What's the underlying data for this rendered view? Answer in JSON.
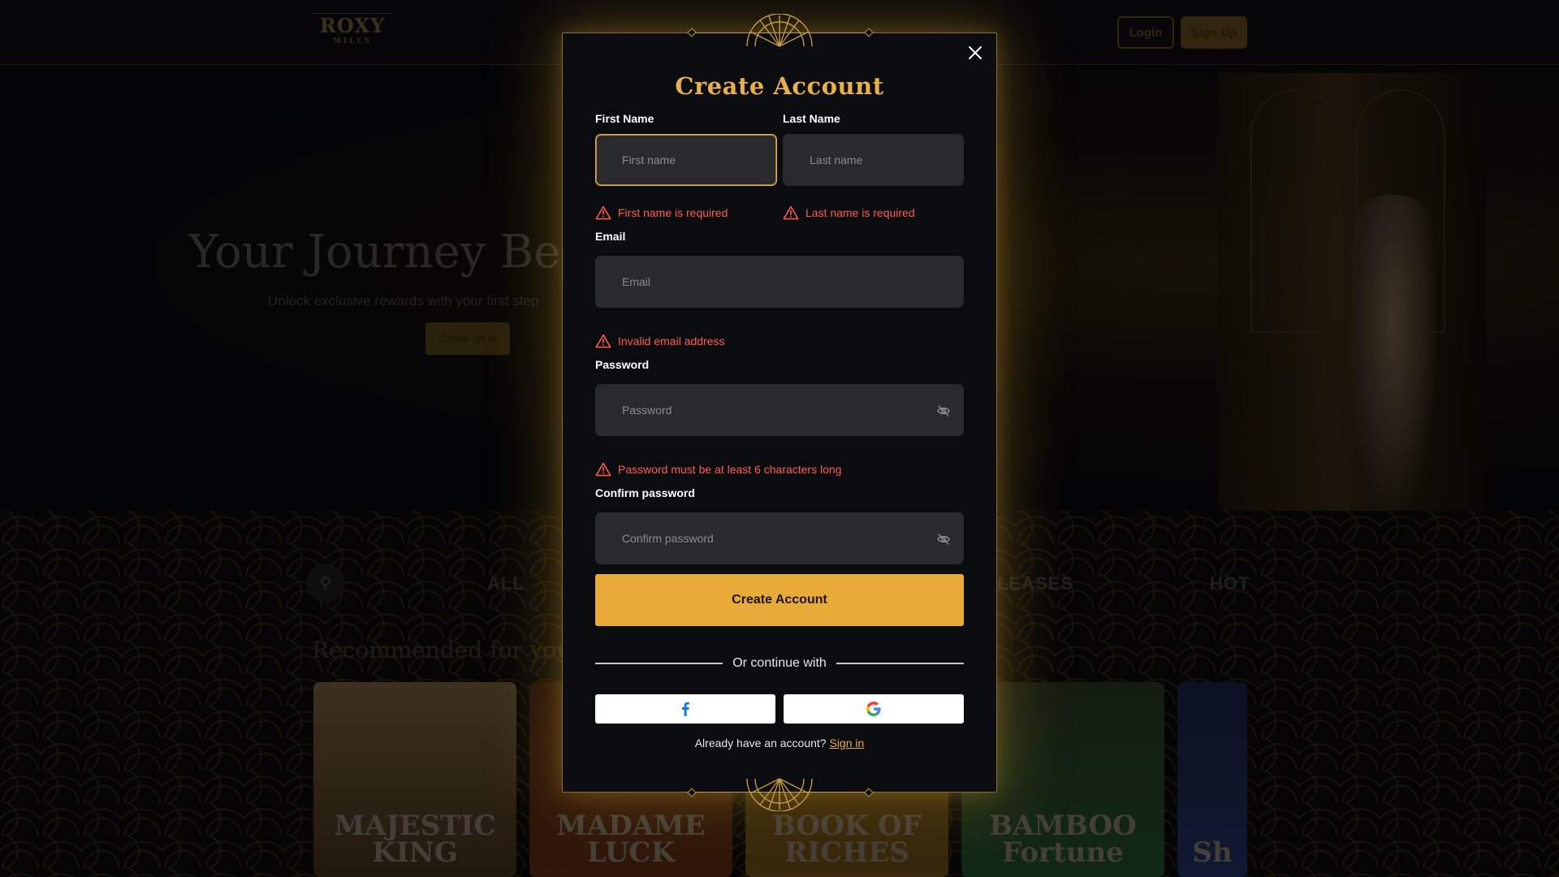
{
  "background": {
    "logo_text": "ROXY",
    "logo_sub": "MILLS",
    "header": {
      "login_label": "Login",
      "signup_label": "Sign Up"
    },
    "hero": {
      "title": "Your Journey Beg",
      "subtitle": "Unlock exclusive rewards with your first step",
      "cta_label": "Come on in"
    },
    "categories": [
      "ALL",
      "LEASES",
      "HOT"
    ],
    "recommended_title": "Recommended for you",
    "games": [
      "MAJESTIC KING",
      "MADAME LUCK",
      "BOOK OF RICHES",
      "BAMBOO Fortune",
      "Sh"
    ]
  },
  "modal": {
    "title": "Create Account",
    "first_name": {
      "label": "First Name",
      "placeholder": "First name",
      "value": "",
      "error": "First name is required"
    },
    "last_name": {
      "label": "Last Name",
      "placeholder": "Last name",
      "value": "",
      "error": "Last name is required"
    },
    "email": {
      "label": "Email",
      "placeholder": "Email",
      "value": "",
      "error": "Invalid email address"
    },
    "password": {
      "label": "Password",
      "placeholder": "Password",
      "value": "",
      "error": "Password must be at least 6 characters long"
    },
    "confirm_password": {
      "label": "Confirm password",
      "placeholder": "Confirm password",
      "value": ""
    },
    "submit_label": "Create Account",
    "divider_text": "Or continue with",
    "signin_prompt": "Already have an account?",
    "signin_link": "Sign in"
  },
  "colors": {
    "accent_gold": "#e9ab37",
    "error_red": "#ff5b52",
    "modal_bg": "#0b0c0f",
    "field_bg": "#2a2a2e"
  },
  "icons": {
    "close": "close-icon",
    "error": "warning-triangle-icon",
    "password_toggle": "eye-off-icon",
    "facebook": "facebook-icon",
    "google": "google-icon"
  }
}
